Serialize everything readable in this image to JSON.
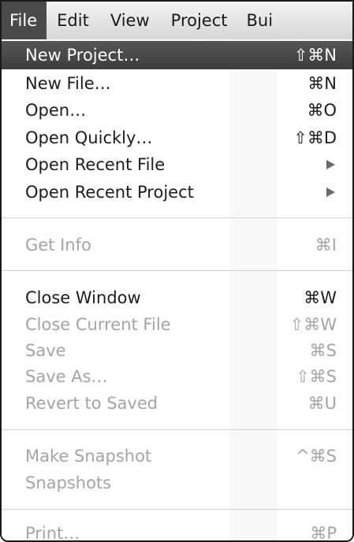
{
  "menubar": {
    "items": [
      {
        "label": "File"
      },
      {
        "label": "Edit"
      },
      {
        "label": "View"
      },
      {
        "label": "Project"
      },
      {
        "label": "Bui"
      }
    ]
  },
  "file_menu": {
    "new_project": {
      "label": "New Project…",
      "shortcut": "⇧⌘N"
    },
    "new_file": {
      "label": "New File…",
      "shortcut": "⌘N"
    },
    "open": {
      "label": "Open…",
      "shortcut": "⌘O"
    },
    "open_quickly": {
      "label": "Open Quickly…",
      "shortcut": "⇧⌘D"
    },
    "open_recent_file": {
      "label": "Open Recent File"
    },
    "open_recent_project": {
      "label": "Open Recent Project"
    },
    "get_info": {
      "label": "Get Info",
      "shortcut": "⌘I"
    },
    "close_window": {
      "label": "Close Window",
      "shortcut": "⌘W"
    },
    "close_current_file": {
      "label": "Close Current File",
      "shortcut": "⇧⌘W"
    },
    "save": {
      "label": "Save",
      "shortcut": "⌘S"
    },
    "save_as": {
      "label": "Save As…",
      "shortcut": "⇧⌘S"
    },
    "revert_to_saved": {
      "label": "Revert to Saved",
      "shortcut": "⌘U"
    },
    "make_snapshot": {
      "label": "Make Snapshot",
      "shortcut": "^⌘S"
    },
    "snapshots": {
      "label": "Snapshots"
    },
    "print": {
      "label": "Print…",
      "shortcut": "⌘P"
    }
  },
  "colors": {
    "highlight": "#4a4a4a",
    "disabled_text": "#a4a4a4",
    "enabled_text": "#1c1c1c"
  }
}
